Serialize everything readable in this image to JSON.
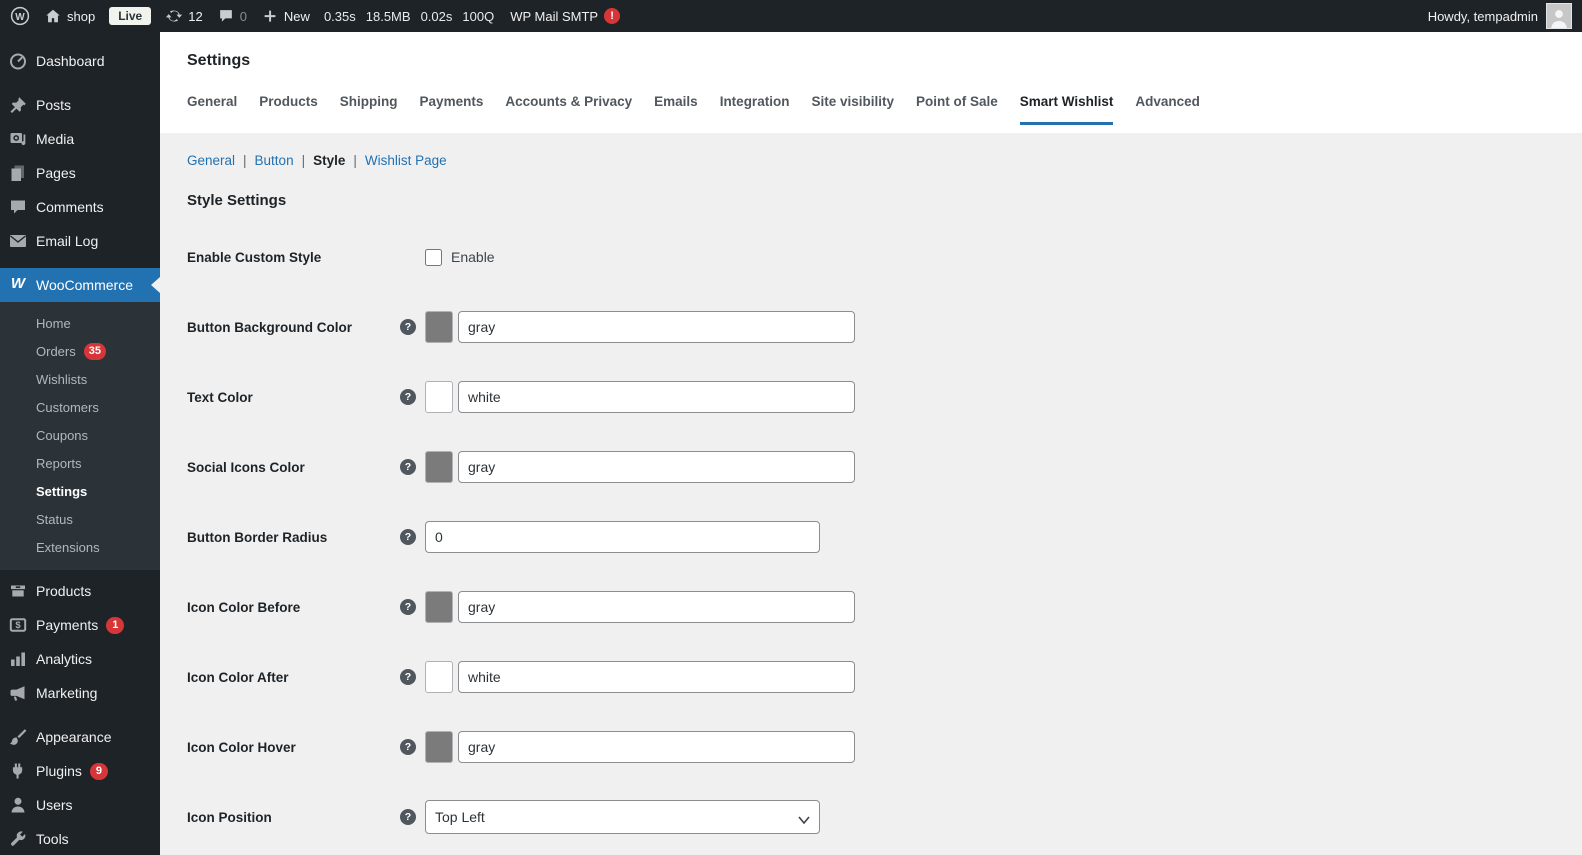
{
  "admin_bar": {
    "site_name": "shop",
    "live_badge": "Live",
    "updates_count": "12",
    "comments_count": "0",
    "new_label": "New",
    "stat_time": "0.35s",
    "stat_memory": "18.5MB",
    "stat_query_time": "0.02s",
    "stat_queries": "100Q",
    "mail_smtp_label": "WP Mail SMTP",
    "mail_smtp_badge": "!",
    "howdy": "Howdy, tempadmin"
  },
  "sidebar": {
    "items_top": [
      {
        "label": "Dashboard"
      },
      {
        "label": "Posts"
      },
      {
        "label": "Media"
      },
      {
        "label": "Pages"
      },
      {
        "label": "Comments"
      },
      {
        "label": "Email Log"
      }
    ],
    "woocommerce_label": "WooCommerce",
    "submenu": [
      {
        "label": "Home"
      },
      {
        "label": "Orders",
        "badge": "35"
      },
      {
        "label": "Wishlists"
      },
      {
        "label": "Customers"
      },
      {
        "label": "Coupons"
      },
      {
        "label": "Reports"
      },
      {
        "label": "Settings"
      },
      {
        "label": "Status"
      },
      {
        "label": "Extensions"
      }
    ],
    "items_bottom": [
      {
        "label": "Products"
      },
      {
        "label": "Payments",
        "badge": "1"
      },
      {
        "label": "Analytics"
      },
      {
        "label": "Marketing"
      },
      {
        "label": "Appearance"
      },
      {
        "label": "Plugins",
        "badge": "9"
      },
      {
        "label": "Users"
      },
      {
        "label": "Tools"
      }
    ]
  },
  "main": {
    "page_title": "Settings",
    "tabs": [
      {
        "label": "General"
      },
      {
        "label": "Products"
      },
      {
        "label": "Shipping"
      },
      {
        "label": "Payments"
      },
      {
        "label": "Accounts & Privacy"
      },
      {
        "label": "Emails"
      },
      {
        "label": "Integration"
      },
      {
        "label": "Site visibility"
      },
      {
        "label": "Point of Sale"
      },
      {
        "label": "Smart Wishlist",
        "active": true
      },
      {
        "label": "Advanced"
      }
    ],
    "subnav_separator": "|",
    "subnav": [
      {
        "label": "General"
      },
      {
        "label": "Button"
      },
      {
        "label": "Style",
        "current": true
      },
      {
        "label": "Wishlist Page"
      }
    ],
    "section_title": "Style Settings",
    "fields": {
      "enable_custom_style": {
        "label": "Enable Custom Style",
        "checkbox_label": "Enable",
        "checked": false
      },
      "button_background_color": {
        "label": "Button Background Color",
        "value": "gray",
        "swatch": "#7b7b7b"
      },
      "text_color": {
        "label": "Text Color",
        "value": "white",
        "swatch": "#ffffff"
      },
      "social_icons_color": {
        "label": "Social Icons Color",
        "value": "gray",
        "swatch": "#7b7b7b"
      },
      "button_border_radius": {
        "label": "Button Border Radius",
        "value": "0"
      },
      "icon_color_before": {
        "label": "Icon Color Before",
        "value": "gray",
        "swatch": "#7b7b7b"
      },
      "icon_color_after": {
        "label": "Icon Color After",
        "value": "white",
        "swatch": "#ffffff"
      },
      "icon_color_hover": {
        "label": "Icon Color Hover",
        "value": "gray",
        "swatch": "#7b7b7b"
      },
      "icon_position": {
        "label": "Icon Position",
        "value": "Top Left"
      }
    }
  },
  "colors": {
    "accent_blue": "#2271b1",
    "badge_red": "#d63638",
    "admin_dark": "#1d2327",
    "submenu_bg": "#2c3338",
    "content_bg": "#f0f0f1"
  }
}
